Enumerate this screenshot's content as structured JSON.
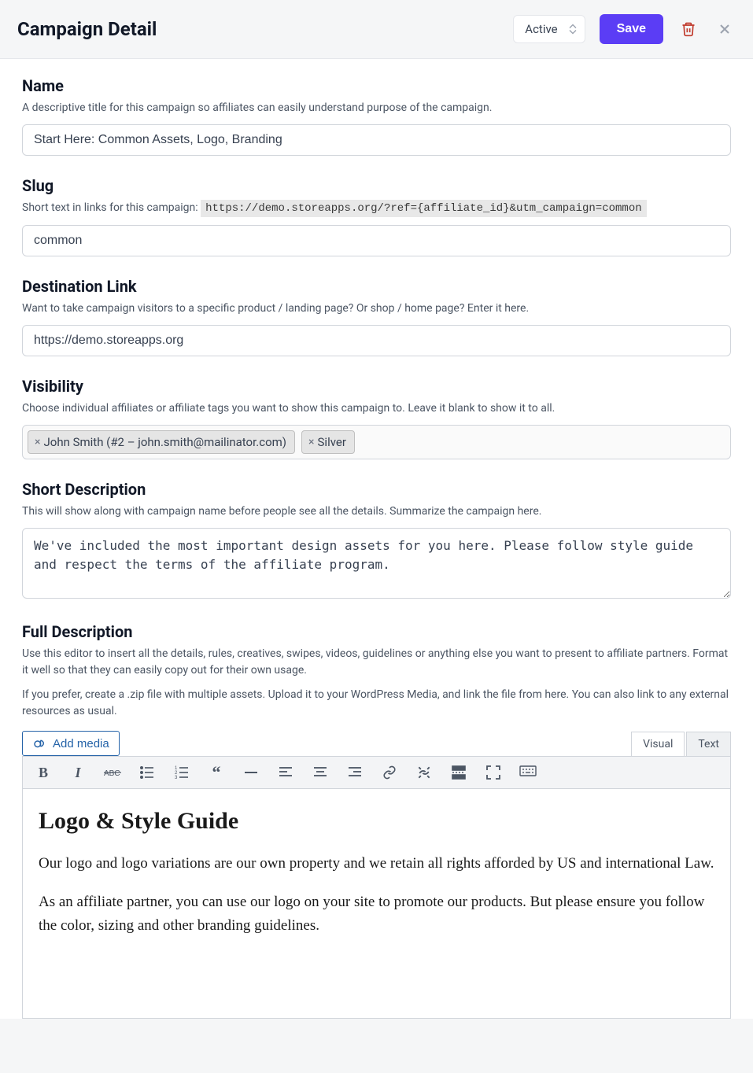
{
  "header": {
    "title": "Campaign Detail",
    "status_value": "Active",
    "save_label": "Save"
  },
  "fields": {
    "name": {
      "label": "Name",
      "help": "A descriptive title for this campaign so affiliates can easily understand purpose of the campaign.",
      "value": "Start Here: Common Assets, Logo, Branding"
    },
    "slug": {
      "label": "Slug",
      "help_prefix": "Short text in links for this campaign: ",
      "help_code": "https://demo.storeapps.org/?ref={affiliate_id}&utm_campaign=common",
      "value": "common"
    },
    "destination": {
      "label": "Destination Link",
      "help": "Want to take campaign visitors to a specific product / landing page? Or shop / home page? Enter it here.",
      "value": "https://demo.storeapps.org"
    },
    "visibility": {
      "label": "Visibility",
      "help": "Choose individual affiliates or affiliate tags you want to show this campaign to. Leave it blank to show it to all.",
      "tags": [
        "John Smith (#2 – john.smith@mailinator.com)",
        "Silver"
      ]
    },
    "short_desc": {
      "label": "Short Description",
      "help": "This will show along with campaign name before people see all the details. Summarize the campaign here.",
      "value": "We've included the most important design assets for you here. Please follow style guide and respect the terms of the affiliate program."
    },
    "full_desc": {
      "label": "Full Description",
      "help1": "Use this editor to insert all the details, rules, creatives, swipes, videos, guidelines or anything else you want to present to affiliate partners. Format it well so that they can easily copy out for their own usage.",
      "help2": "If you prefer, create a .zip file with multiple assets. Upload it to your WordPress Media, and link the file from here. You can also link to any external resources as usual."
    }
  },
  "editor": {
    "add_media_label": "Add media",
    "tab_visual": "Visual",
    "tab_text": "Text",
    "content_heading": "Logo & Style Guide",
    "content_p1": "Our logo and logo variations are our own property and we retain all rights afforded by US and international Law.",
    "content_p2": "As an affiliate partner, you can use our logo on your site to promote our products. But please ensure you follow the color, sizing and other branding guidelines."
  }
}
